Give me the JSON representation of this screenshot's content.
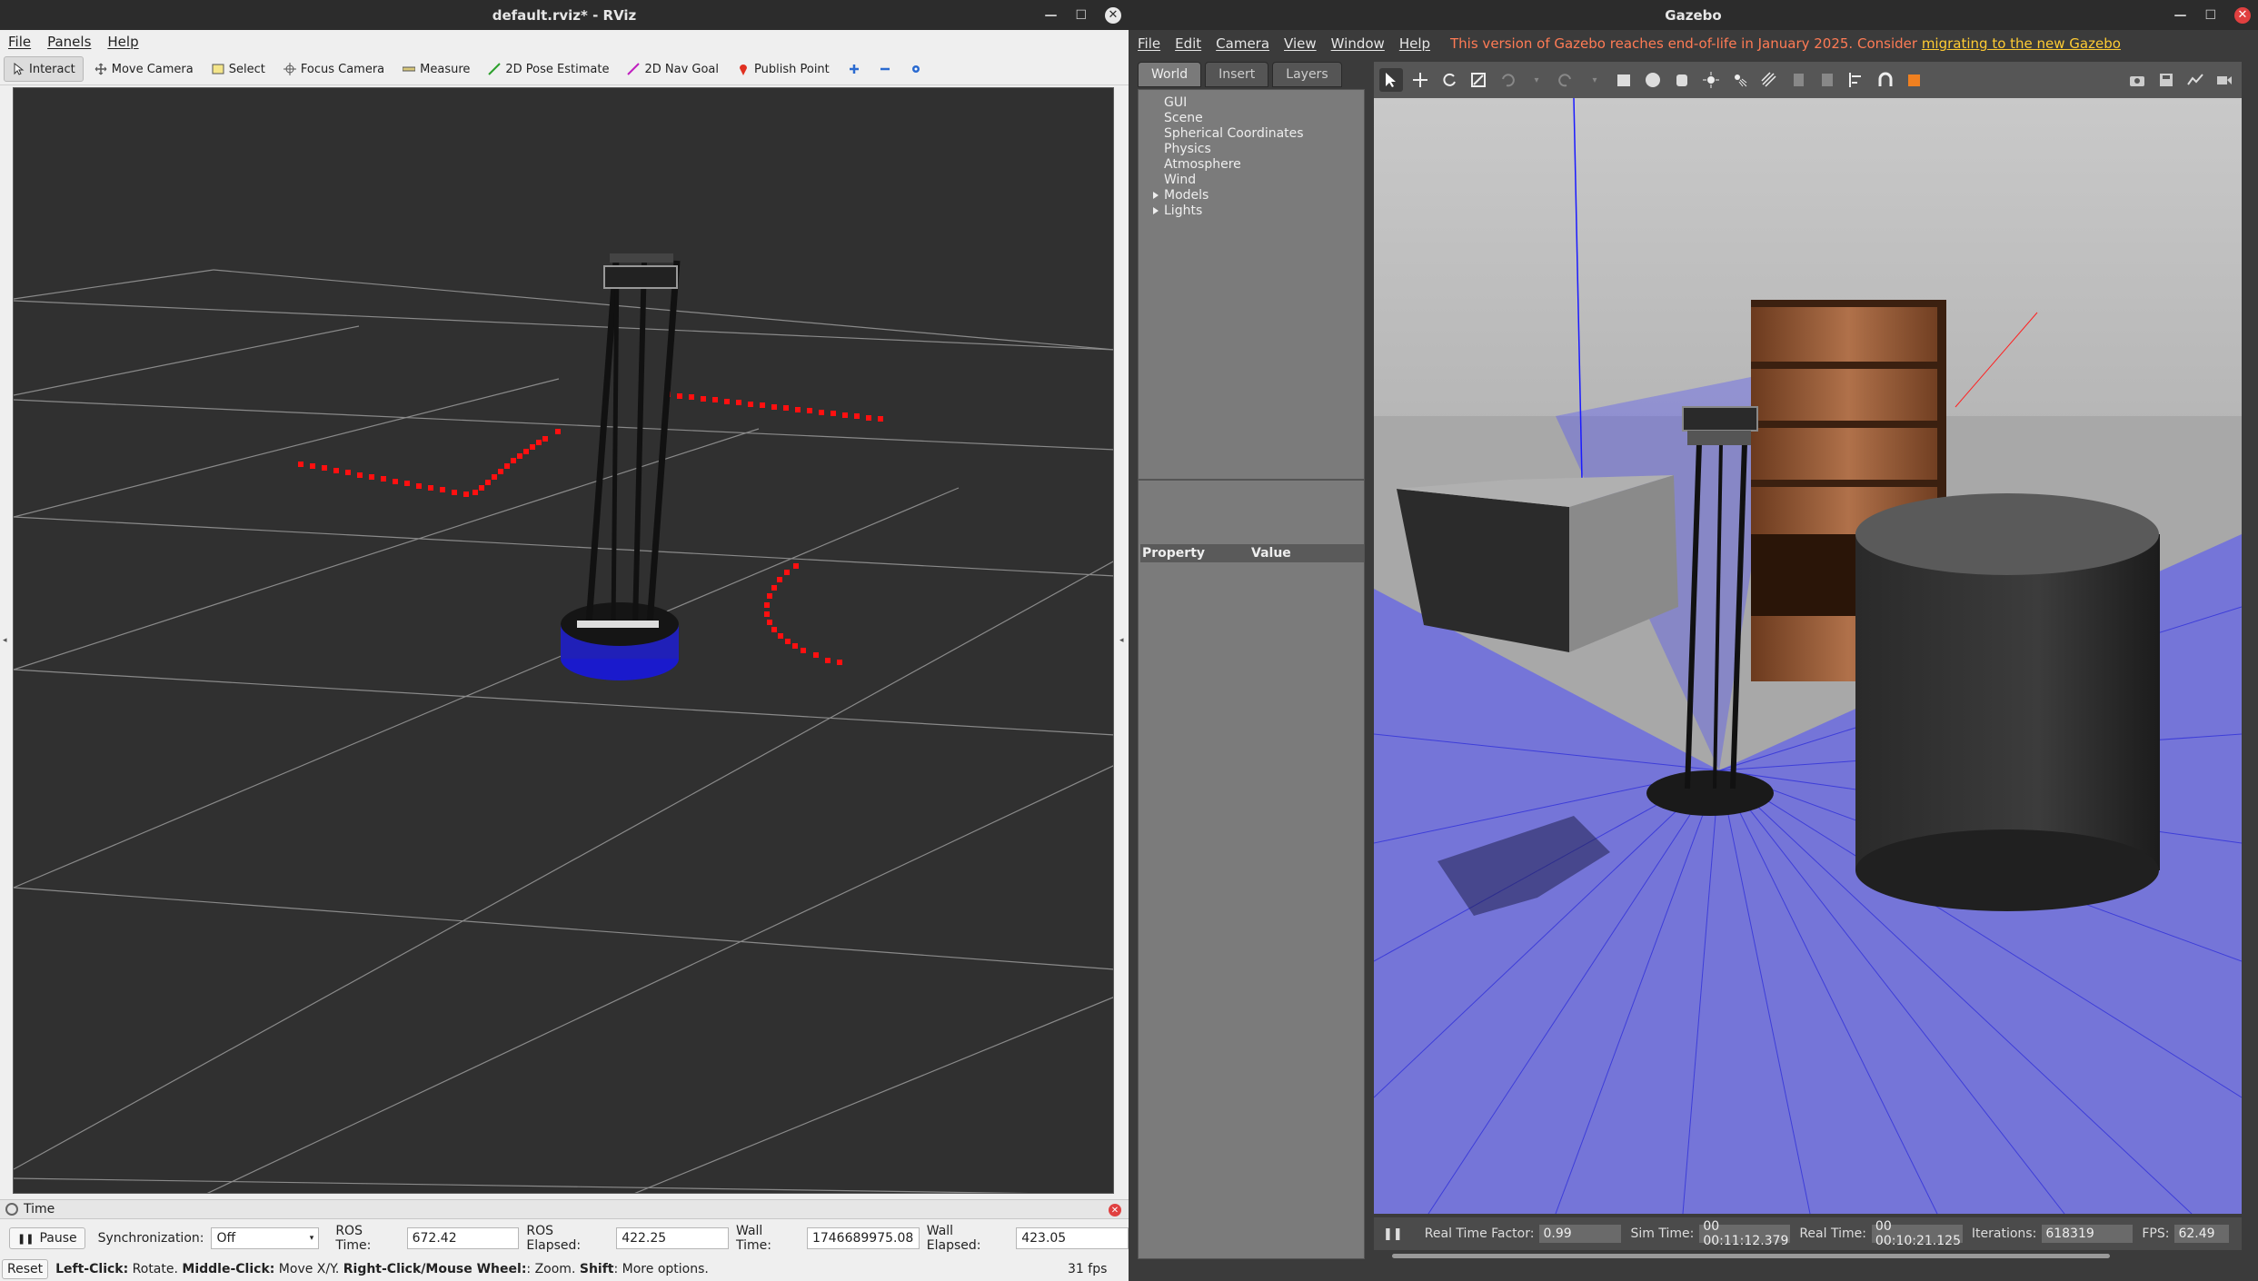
{
  "rviz": {
    "title": "default.rviz* - RViz",
    "menu": [
      "File",
      "Panels",
      "Help"
    ],
    "tools": [
      {
        "label": "Interact",
        "icon": "interact-icon"
      },
      {
        "label": "Move Camera",
        "icon": "move-camera-icon"
      },
      {
        "label": "Select",
        "icon": "select-icon"
      },
      {
        "label": "Focus Camera",
        "icon": "focus-camera-icon"
      },
      {
        "label": "Measure",
        "icon": "measure-icon"
      },
      {
        "label": "2D Pose Estimate",
        "icon": "pose-estimate-icon"
      },
      {
        "label": "2D Nav Goal",
        "icon": "nav-goal-icon"
      },
      {
        "label": "Publish Point",
        "icon": "publish-point-icon"
      }
    ],
    "time_panel": {
      "title": "Time",
      "pause_label": "Pause",
      "sync_label": "Synchronization:",
      "sync_value": "Off",
      "ros_time_label": "ROS Time:",
      "ros_time": "672.42",
      "ros_elapsed_label": "ROS Elapsed:",
      "ros_elapsed": "422.25",
      "wall_time_label": "Wall Time:",
      "wall_time": "1746689975.08",
      "wall_elapsed_label": "Wall Elapsed:",
      "wall_elapsed": "423.05"
    },
    "status": {
      "reset_label": "Reset",
      "hint_leftclick_b": "Left-Click:",
      "hint_leftclick": " Rotate. ",
      "hint_middle_b": "Middle-Click:",
      "hint_middle": " Move X/Y. ",
      "hint_right_b": "Right-Click/Mouse Wheel:",
      "hint_right": ": Zoom. ",
      "hint_shift_b": "Shift",
      "hint_shift": ": More options.",
      "fps": "31 fps"
    },
    "colors": {
      "grid_bg": "#303030",
      "laser": "#ff0000",
      "robot_base": "#1a1ad0"
    }
  },
  "gazebo": {
    "title": "Gazebo",
    "menu": [
      "File",
      "Edit",
      "Camera",
      "View",
      "Window",
      "Help"
    ],
    "eol_text": "This version of Gazebo reaches end-of-life in January 2025. Consider ",
    "eol_link": "migrating to the new Gazebo",
    "tabs": [
      "World",
      "Insert",
      "Layers"
    ],
    "tree": [
      {
        "label": "GUI",
        "expandable": false
      },
      {
        "label": "Scene",
        "expandable": false
      },
      {
        "label": "Spherical Coordinates",
        "expandable": false
      },
      {
        "label": "Physics",
        "expandable": false
      },
      {
        "label": "Atmosphere",
        "expandable": false
      },
      {
        "label": "Wind",
        "expandable": false
      },
      {
        "label": "Models",
        "expandable": true
      },
      {
        "label": "Lights",
        "expandable": true
      }
    ],
    "props_header": {
      "property": "Property",
      "value": "Value"
    },
    "status": {
      "rtf_label": "Real Time Factor:",
      "rtf": "0.99",
      "sim_time_label": "Sim Time:",
      "sim_time": "00 00:11:12.379",
      "real_time_label": "Real Time:",
      "real_time": "00 00:10:21.125",
      "iterations_label": "Iterations:",
      "iterations": "618319",
      "fps_label": "FPS:",
      "fps": "62.49"
    },
    "colors": {
      "eol": "#ff7b55",
      "link": "#ffcc33",
      "laser_fan": "#4a4aff"
    }
  }
}
